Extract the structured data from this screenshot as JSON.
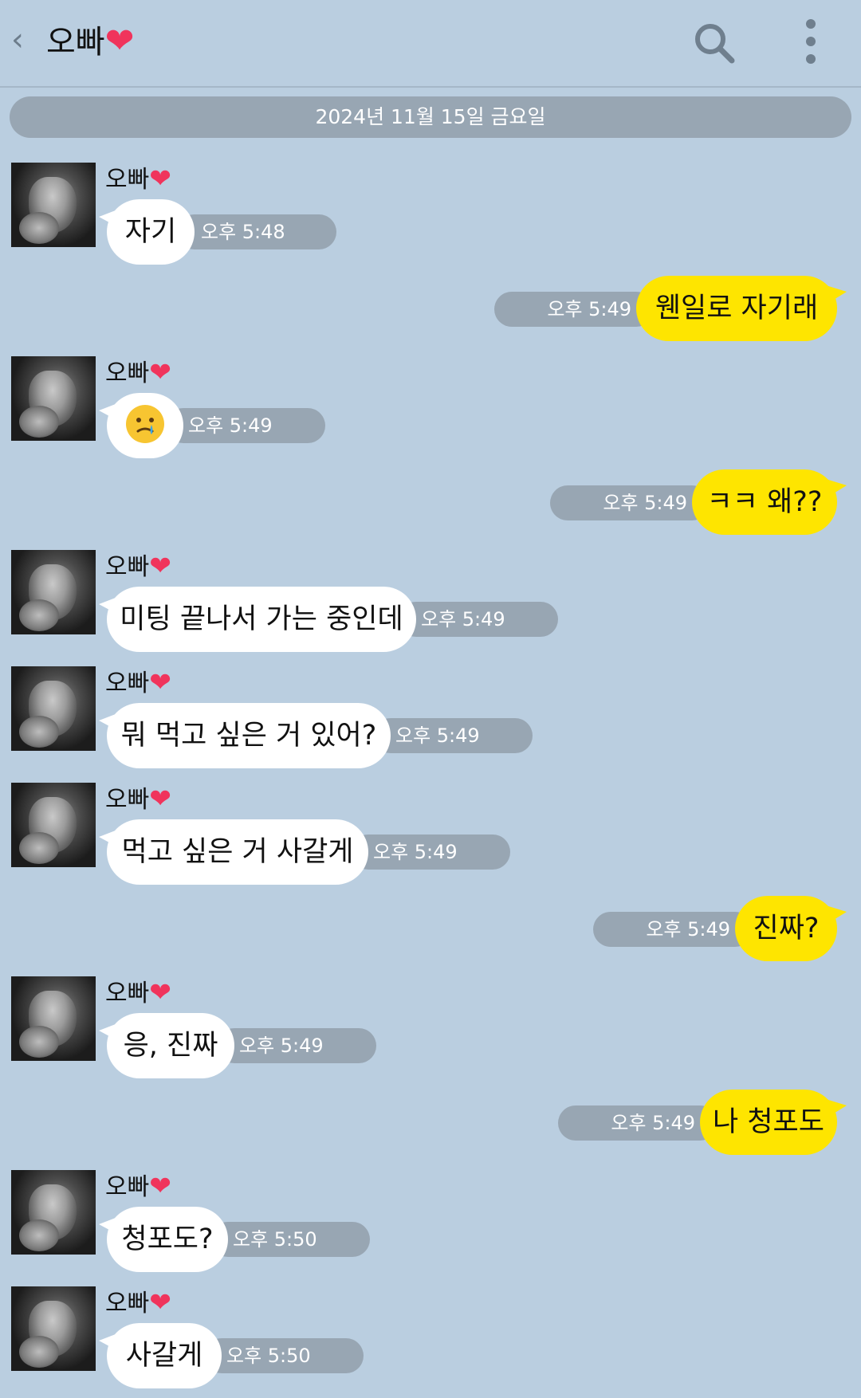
{
  "header": {
    "back_glyph": "‹",
    "title": "오빠",
    "title_emoji": "❤"
  },
  "date_label": "2024년 11월 15일 금요일",
  "sender_name": "오빠",
  "sender_emoji": "❤",
  "messages": [
    {
      "from": "them",
      "text": "자기",
      "time": "오후 5:48"
    },
    {
      "from": "me",
      "text": "웬일로 자기래",
      "time": "오후 5:49"
    },
    {
      "from": "them",
      "text": "",
      "emoji_icon": "crying-face-emoji",
      "time": "오후 5:49"
    },
    {
      "from": "me",
      "text": "ㅋㅋ 왜??",
      "time": "오후 5:49"
    },
    {
      "from": "them",
      "text": "미팅 끝나서 가는 중인데",
      "time": "오후 5:49"
    },
    {
      "from": "them",
      "text": "뭐 먹고 싶은 거 있어?",
      "time": "오후 5:49"
    },
    {
      "from": "them",
      "text": "먹고 싶은 거 사갈게",
      "time": "오후 5:49"
    },
    {
      "from": "me",
      "text": "진짜?",
      "time": "오후 5:49"
    },
    {
      "from": "them",
      "text": "응, 진짜",
      "time": "오후 5:49"
    },
    {
      "from": "me",
      "text": "나 청포도",
      "time": "오후 5:49"
    },
    {
      "from": "them",
      "text": "청포도?",
      "time": "오후 5:50"
    },
    {
      "from": "them",
      "text": "사갈게",
      "time": "오후 5:50"
    }
  ],
  "colors": {
    "background": "#bacee0",
    "my_bubble": "#fee500",
    "their_bubble": "#ffffff",
    "time_pill": "#98a6b3",
    "heart": "#f0345c"
  }
}
